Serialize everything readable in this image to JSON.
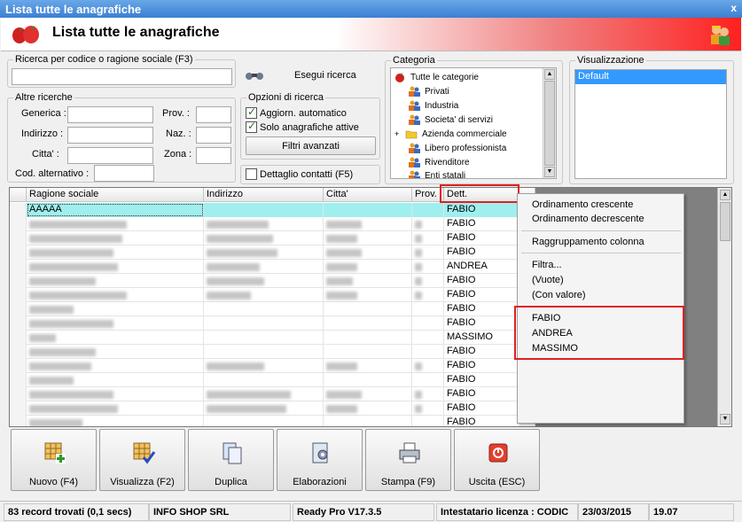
{
  "window": {
    "title": "Lista tutte le anagrafiche",
    "close_label": "x"
  },
  "header": {
    "title": "Lista tutte le anagrafiche"
  },
  "search": {
    "legend": "Ricerca per codice o ragione sociale (F3)",
    "value": "",
    "button_label": "Esegui ricerca"
  },
  "other_searches": {
    "legend": "Altre ricerche",
    "generica_label": "Generica :",
    "indirizzo_label": "Indirizzo :",
    "citta_label": "Citta' :",
    "cod_alt_label": "Cod. alternativo :",
    "prov_label": "Prov. :",
    "naz_label": "Naz. :",
    "zona_label": "Zona :"
  },
  "options": {
    "legend": "Opzioni di ricerca",
    "aggiorn_label": "Aggiorn. automatico",
    "aggiorn_checked": true,
    "solo_label": "Solo anagrafiche attive",
    "solo_checked": true,
    "filtri_label": "Filtri avanzati"
  },
  "dettaglio": {
    "label": "Dettaglio contatti (F5)",
    "checked": false
  },
  "category": {
    "legend": "Categoria",
    "items": [
      "Tutte le categorie",
      "Privati",
      "Industria",
      "Societa' di servizi",
      "Azienda commerciale",
      "Libero professionista",
      "Rivenditore",
      "Enti statali"
    ],
    "expand_label": "+"
  },
  "visualizzazione": {
    "legend": "Visualizzazione",
    "selected": "Default"
  },
  "grid": {
    "columns": [
      "Ragione sociale",
      "Indirizzo",
      "Citta'",
      "Prov.",
      "Dett."
    ],
    "first_row_name": "AAAAA",
    "dett_values": [
      "FABIO",
      "FABIO",
      "FABIO",
      "FABIO",
      "ANDREA",
      "FABIO",
      "FABIO",
      "FABIO",
      "FABIO",
      "MASSIMO",
      "FABIO",
      "FABIO",
      "FABIO",
      "FABIO",
      "FABIO",
      "FABIO"
    ]
  },
  "context_menu": {
    "sort_asc": "Ordinamento crescente",
    "sort_desc": "Ordinamento decrescente",
    "group_col": "Raggruppamento colonna",
    "filter": "Filtra...",
    "empty": "(Vuote)",
    "with_value": "(Con valore)",
    "values": [
      "FABIO",
      "ANDREA",
      "MASSIMO"
    ]
  },
  "toolbar": {
    "nuovo": "Nuovo (F4)",
    "visualizza": "Visualizza (F2)",
    "duplica": "Duplica",
    "elaborazioni": "Elaborazioni",
    "stampa": "Stampa (F9)",
    "uscita": "Uscita (ESC)"
  },
  "status": {
    "records": "83 record trovati (0,1 secs)",
    "company": "INFO SHOP SRL",
    "version": "Ready Pro V17.3.5",
    "license": "Intestatario licenza : CODIC",
    "date": "23/03/2015",
    "time": "19.07"
  },
  "colors": {
    "accent_red": "#e02020",
    "selection_blue": "#3399ff",
    "row_highlight": "#9fefef"
  }
}
